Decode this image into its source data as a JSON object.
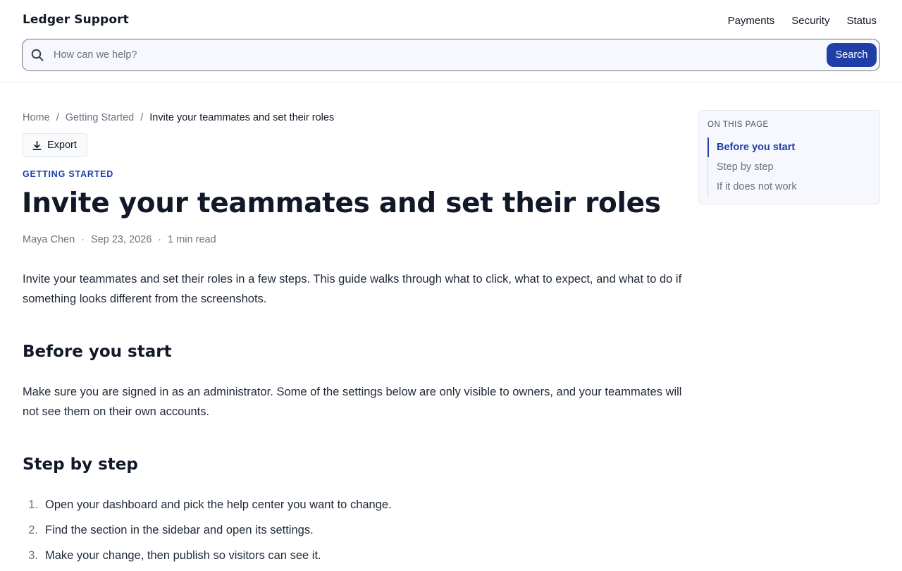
{
  "header": {
    "brand": "Ledger Support",
    "nav": [
      "Payments",
      "Security",
      "Status"
    ]
  },
  "search": {
    "placeholder": "How can we help?",
    "button_label": "Search",
    "icon": "search-icon"
  },
  "breadcrumb": {
    "home": "Home",
    "section": "Getting Started",
    "current": "Invite your teammates and set their roles",
    "separator": "/"
  },
  "toolbar": {
    "export_label": "Export",
    "export_icon": "download-icon"
  },
  "article": {
    "category": "GETTING STARTED",
    "title": "Invite your teammates and set their roles",
    "author": "Maya Chen",
    "date": "Sep 23, 2026",
    "read_time": "1 min read",
    "meta_separator": "·",
    "intro": "Invite your teammates and set their roles in a few steps. This guide walks through what to click, what to expect, and what to do if something looks different from the screenshots.",
    "sections": [
      {
        "heading": "Before you start",
        "body": "Make sure you are signed in as an administrator. Some of the settings below are only visible to owners, and your teammates will not see them on their own accounts."
      },
      {
        "heading": "Step by step",
        "steps": [
          "Open your dashboard and pick the help center you want to change.",
          "Find the section in the sidebar and open its settings.",
          "Make your change, then publish so visitors can see it."
        ]
      }
    ]
  },
  "toc": {
    "heading": "ON THIS PAGE",
    "items": [
      {
        "label": "Before you start",
        "active": true
      },
      {
        "label": "Step by step",
        "active": false
      },
      {
        "label": "If it does not work",
        "active": false
      }
    ]
  },
  "colors": {
    "accent": "#1f3ea8",
    "text": "#111827",
    "muted": "#6b7280",
    "panel": "#f6f8fd"
  }
}
